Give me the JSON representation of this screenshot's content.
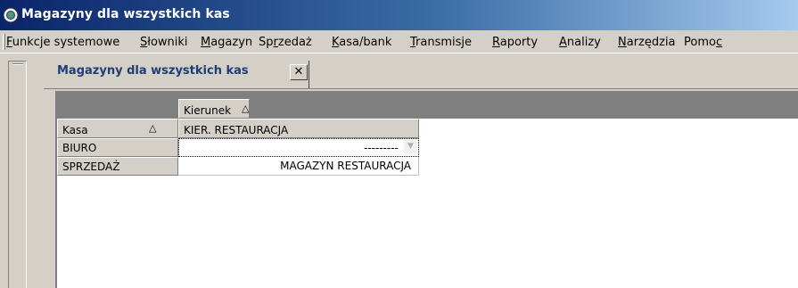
{
  "window": {
    "title": "Magazyny dla wszystkich kas"
  },
  "menu": [
    {
      "label": "Funkcje systemowe",
      "hotkey_index": 0
    },
    {
      "label": "Słowniki",
      "hotkey_index": 0
    },
    {
      "label": "Magazyn",
      "hotkey_index": 0
    },
    {
      "label": "Sprzedaż",
      "hotkey_index": 2
    },
    {
      "label": "Kasa/bank",
      "hotkey_index": 0
    },
    {
      "label": "Transmisje",
      "hotkey_index": 0
    },
    {
      "label": "Raporty",
      "hotkey_index": 0
    },
    {
      "label": "Analizy",
      "hotkey_index": 0
    },
    {
      "label": "Narzędzia",
      "hotkey_index": 0
    },
    {
      "label": "Pomoc",
      "hotkey_index": 4
    }
  ],
  "tab": {
    "label": "Magazyny dla wszystkich kas",
    "close": "✕"
  },
  "grid": {
    "column_group_header": "Kierunek",
    "row_header_title": "Kasa",
    "sort_glyph": "△",
    "column_header": "KIER. RESTAURACJA",
    "rows": [
      {
        "kasa": "BIURO",
        "value": "---------",
        "editing": true,
        "dropdown_glyph": "▼"
      },
      {
        "kasa": "SPRZEDAŻ",
        "value": "MAGAZYN RESTAURACJA",
        "editing": false
      }
    ]
  },
  "colors": {
    "title_start": "#0a246a",
    "title_end": "#a6caf0",
    "tab_text": "#1e3c78",
    "chrome": "#d4d0c8"
  }
}
